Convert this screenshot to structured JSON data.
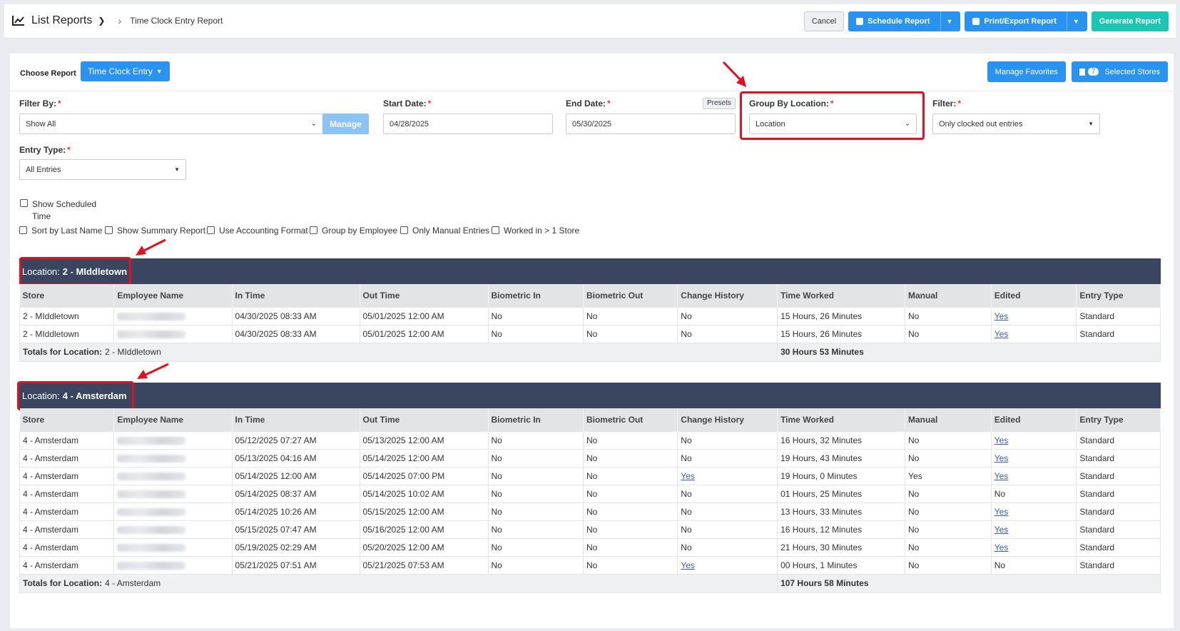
{
  "header": {
    "title": "List Reports",
    "subtitle": "Time Clock Entry Report",
    "cancel": "Cancel",
    "schedule": "Schedule Report",
    "print": "Print/Export Report",
    "generate": "Generate Report"
  },
  "toolbar": {
    "choose_label": "Choose Report",
    "report_type": "Time Clock Entry",
    "manage_favorites": "Manage Favorites",
    "stores_count": "7",
    "selected_stores": "Selected Stores"
  },
  "filters": {
    "filter_by_label": "Filter By:",
    "filter_by_value": "Show All",
    "manage": "Manage",
    "start_label": "Start Date:",
    "start_value": "04/28/2025",
    "end_label": "End Date:",
    "end_value": "05/30/2025",
    "presets": "Presets",
    "group_label": "Group By Location:",
    "group_value": "Location",
    "filter_label": "Filter:",
    "filter_value": "Only clocked out entries",
    "entry_label": "Entry Type:",
    "entry_value": "All Entries",
    "required_mark": "*"
  },
  "options": {
    "show_scheduled_1": "Show Scheduled",
    "show_scheduled_2": "Time",
    "sort_last": "Sort by Last Name",
    "summary": "Show Summary Report",
    "accounting": "Use Accounting Format",
    "group_emp": "Group by Employee",
    "manual_only": "Only Manual Entries",
    "worked_multi": "Worked in > 1 Store"
  },
  "columns": [
    "Store",
    "Employee Name",
    "In Time",
    "Out Time",
    "Biometric In",
    "Biometric Out",
    "Change History",
    "Time Worked",
    "Manual",
    "Edited",
    "Entry Type"
  ],
  "groups": [
    {
      "label": "Location:",
      "name": "2 - MIddletown",
      "totals_label": "Totals for Location:",
      "totals_name": "2 - MIddletown",
      "total": "30 Hours 53 Minutes",
      "rows": [
        [
          "2 - MIddletown",
          "",
          "04/30/2025 08:33 AM",
          "05/01/2025 12:00 AM",
          "No",
          "No",
          "No",
          "15 Hours, 26 Minutes",
          "No",
          "Yes",
          "Standard"
        ],
        [
          "2 - MIddletown",
          "",
          "04/30/2025 08:33 AM",
          "05/01/2025 12:00 AM",
          "No",
          "No",
          "No",
          "15 Hours, 26 Minutes",
          "No",
          "Yes",
          "Standard"
        ]
      ]
    },
    {
      "label": "Location:",
      "name": "4 - Amsterdam",
      "totals_label": "Totals for Location:",
      "totals_name": "4 - Amsterdam",
      "total": "107 Hours 58 Minutes",
      "rows": [
        [
          "4 - Amsterdam",
          "",
          "05/12/2025 07:27 AM",
          "05/13/2025 12:00 AM",
          "No",
          "No",
          "No",
          "16 Hours, 32 Minutes",
          "No",
          "Yes",
          "Standard"
        ],
        [
          "4 - Amsterdam",
          "",
          "05/13/2025 04:16 AM",
          "05/14/2025 12:00 AM",
          "No",
          "No",
          "No",
          "19 Hours, 43 Minutes",
          "No",
          "Yes",
          "Standard"
        ],
        [
          "4 - Amsterdam",
          "",
          "05/14/2025 12:00 AM",
          "05/14/2025 07:00 PM",
          "No",
          "No",
          "Yes",
          "19 Hours, 0 Minutes",
          "Yes",
          "Yes",
          "Standard"
        ],
        [
          "4 - Amsterdam",
          "",
          "05/14/2025 08:37 AM",
          "05/14/2025 10:02 AM",
          "No",
          "No",
          "No",
          "01 Hours, 25 Minutes",
          "No",
          "No",
          "Standard"
        ],
        [
          "4 - Amsterdam",
          "",
          "05/14/2025 10:26 AM",
          "05/15/2025 12:00 AM",
          "No",
          "No",
          "No",
          "13 Hours, 33 Minutes",
          "No",
          "Yes",
          "Standard"
        ],
        [
          "4 - Amsterdam",
          "",
          "05/15/2025 07:47 AM",
          "05/16/2025 12:00 AM",
          "No",
          "No",
          "No",
          "16 Hours, 12 Minutes",
          "No",
          "Yes",
          "Standard"
        ],
        [
          "4 - Amsterdam",
          "",
          "05/19/2025 02:29 AM",
          "05/20/2025 12:00 AM",
          "No",
          "No",
          "No",
          "21 Hours, 30 Minutes",
          "No",
          "Yes",
          "Standard"
        ],
        [
          "4 - Amsterdam",
          "",
          "05/21/2025 07:51 AM",
          "05/21/2025 07:53 AM",
          "No",
          "No",
          "Yes",
          "00 Hours, 1 Minutes",
          "No",
          "No",
          "Standard"
        ]
      ]
    }
  ],
  "colors": {
    "accent": "#2a93f2",
    "teal": "#1dc5b3",
    "header_dark": "#3a4660",
    "highlight": "#e3101f"
  }
}
